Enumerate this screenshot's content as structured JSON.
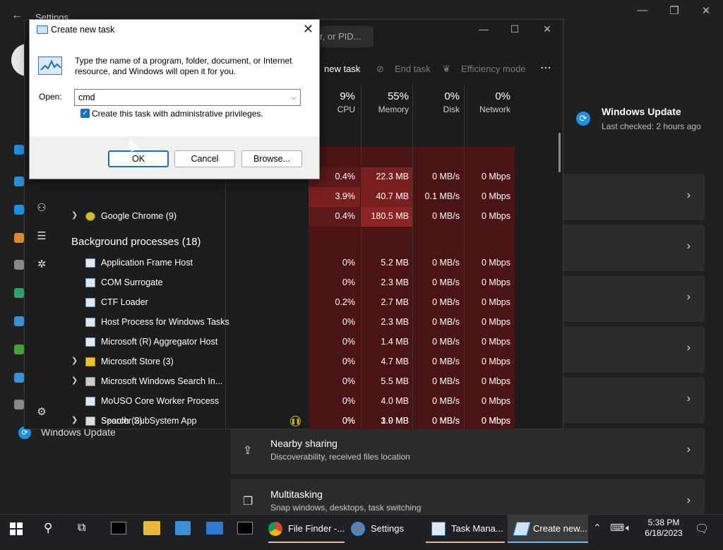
{
  "settings": {
    "title": "Settings",
    "windows_update_card": {
      "title": "Windows Update",
      "subtitle": "Last checked: 2 hours ago"
    },
    "nav_windows_update": "Windows Update",
    "cards": [
      {
        "title": "Nearby sharing",
        "subtitle": "Discoverability, received files location",
        "icon": "share-icon"
      },
      {
        "title": "Multitasking",
        "subtitle": "Snap windows, desktops, task switching",
        "icon": "multitask-icon"
      }
    ]
  },
  "task_manager": {
    "search_placeholder": "r, or PID...",
    "toolbar": {
      "new_task": "new task",
      "end_task": "End task",
      "efficiency_mode": "Efficiency mode",
      "more": "⋯"
    },
    "columns": [
      {
        "percent": "9%",
        "label": "CPU"
      },
      {
        "percent": "55%",
        "label": "Memory"
      },
      {
        "percent": "0%",
        "label": "Disk"
      },
      {
        "percent": "0%",
        "label": "Network"
      }
    ],
    "apps_rows": [
      {
        "name": "",
        "cpu": "0.4%",
        "memory": "22.3 MB",
        "disk": "0 MB/s",
        "network": "0 Mbps"
      },
      {
        "name": "",
        "cpu": "3.9%",
        "memory": "40.7 MB",
        "disk": "0.1 MB/s",
        "network": "0 Mbps"
      },
      {
        "name": "Google Chrome (9)",
        "cpu": "0.4%",
        "memory": "180.5 MB",
        "disk": "0 MB/s",
        "network": "0 Mbps"
      }
    ],
    "background_header": "Background processes (18)",
    "bg_rows": [
      {
        "name": "Application Frame Host",
        "cpu": "0%",
        "memory": "5.2 MB",
        "disk": "0 MB/s",
        "network": "0 Mbps"
      },
      {
        "name": "COM Surrogate",
        "cpu": "0%",
        "memory": "2.3 MB",
        "disk": "0 MB/s",
        "network": "0 Mbps"
      },
      {
        "name": "CTF Loader",
        "cpu": "0.2%",
        "memory": "2.7 MB",
        "disk": "0 MB/s",
        "network": "0 Mbps"
      },
      {
        "name": "Host Process for Windows Tasks",
        "cpu": "0%",
        "memory": "2.3 MB",
        "disk": "0 MB/s",
        "network": "0 Mbps"
      },
      {
        "name": "Microsoft (R) Aggregator Host",
        "cpu": "0%",
        "memory": "1.4 MB",
        "disk": "0 MB/s",
        "network": "0 Mbps"
      },
      {
        "name": "Microsoft Store (3)",
        "cpu": "0%",
        "memory": "4.7 MB",
        "disk": "0 MB/s",
        "network": "0 Mbps"
      },
      {
        "name": "Microsoft Windows Search In...",
        "cpu": "0%",
        "memory": "5.5 MB",
        "disk": "0 MB/s",
        "network": "0 Mbps"
      },
      {
        "name": "MoUSO Core Worker Process",
        "cpu": "0%",
        "memory": "4.0 MB",
        "disk": "0 MB/s",
        "network": "0 Mbps"
      },
      {
        "name": "Search (2)",
        "cpu": "0%",
        "memory": "3.9 MB",
        "disk": "0 MB/s",
        "network": "0 Mbps"
      },
      {
        "name": "Spooler SubSystem App",
        "cpu": "0%",
        "memory": "1.0 MB",
        "disk": "0 MB/s",
        "network": "0 Mbps"
      }
    ]
  },
  "dialog": {
    "title": "Create new task",
    "message": "Type the name of a program, folder, document, or Internet resource, and Windows will open it for you.",
    "open_label": "Open:",
    "open_value": "cmd",
    "admin_label": "Create this task with administrative privileges.",
    "ok": "OK",
    "cancel": "Cancel",
    "browse": "Browse..."
  },
  "taskbar": {
    "apps": [
      {
        "label": "File Finder -...",
        "icon": "chrome-icon"
      },
      {
        "label": "Settings",
        "icon": "settings-icon"
      },
      {
        "label": "Task Mana...",
        "icon": "task-manager-icon"
      },
      {
        "label": "Create new...",
        "icon": "run-icon"
      }
    ],
    "time": "5:38 PM",
    "date": "6/18/2023"
  },
  "colors": {
    "heat_dark": "#4a1414",
    "heat_med": "#5c1919",
    "heat_strong": "#7a1f1f",
    "accent": "#1a6fbf"
  }
}
